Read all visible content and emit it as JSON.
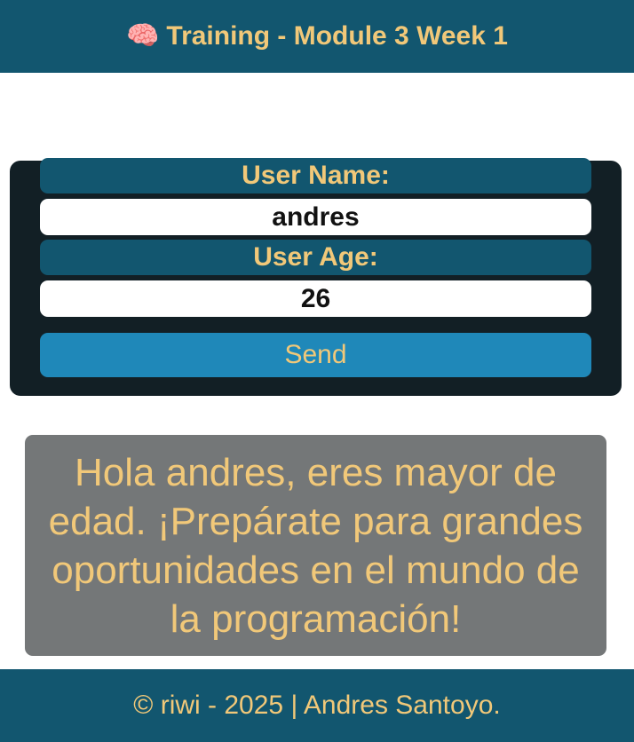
{
  "header": {
    "icon": "brain-icon",
    "icon_glyph": "🧠",
    "title": "Training - Module 3 Week 1"
  },
  "form": {
    "name_label": "User Name:",
    "name_value": "andres",
    "age_label": "User Age:",
    "age_value": "26",
    "send_label": "Send"
  },
  "result": {
    "message": "Hola andres, eres mayor de edad. ¡Prepárate para grandes oportunidades en el mundo de la programación!"
  },
  "footer": {
    "text": "© riwi - 2025 | Andres Santoyo."
  },
  "colors": {
    "header_bg": "#12566f",
    "accent_text": "#f1c879",
    "card_bg": "#121f25",
    "button_bg": "#1f88b9",
    "result_bg": "#747778"
  }
}
